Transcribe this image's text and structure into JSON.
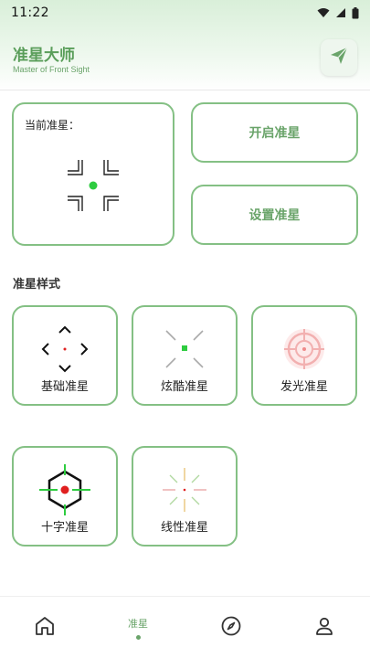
{
  "status_bar": {
    "time": "11:22"
  },
  "header": {
    "title": "准星大师",
    "subtitle": "Master of Front Sight"
  },
  "current": {
    "label": "当前准星："
  },
  "actions": {
    "open_label": "开启准星",
    "settings_label": "设置准星"
  },
  "section": {
    "title": "准星样式"
  },
  "styles": [
    {
      "label": "基础准星"
    },
    {
      "label": "炫酷准星"
    },
    {
      "label": "发光准星"
    },
    {
      "label": "十字准星"
    },
    {
      "label": "线性准星"
    }
  ],
  "nav": {
    "active_label": "准星",
    "items": [
      "home-icon",
      "crosshair-tab",
      "compass-icon",
      "profile-icon"
    ]
  },
  "colors": {
    "accent": "#6aa46a",
    "border": "#84c084",
    "green_dot": "#2ecc40",
    "red_dot": "#e02020"
  }
}
